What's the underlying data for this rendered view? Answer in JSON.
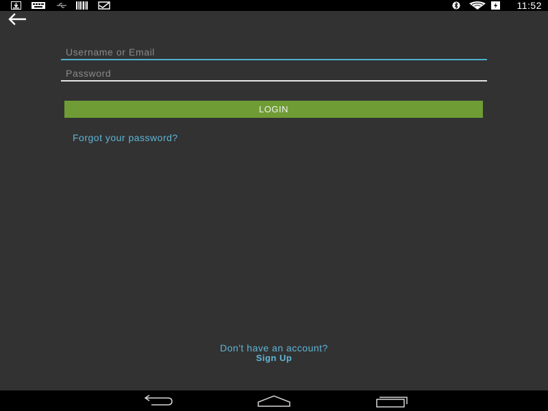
{
  "status_bar": {
    "time": "11:52",
    "left_icons": [
      "download-icon",
      "keyboard-icon",
      "usb-icon",
      "barcode-icon",
      "check-envelope-icon"
    ],
    "right_icons": [
      "bluetooth-icon",
      "wifi-icon",
      "battery-icon"
    ]
  },
  "toolbar": {
    "back_icon": "arrow-left-icon"
  },
  "login_form": {
    "username_placeholder": "Username or Email",
    "username_value": "",
    "password_placeholder": "Password",
    "password_value": "",
    "login_label": "LOGIN",
    "forgot_label": "Forgot your password?"
  },
  "signup": {
    "prompt": "Don't have an account?",
    "link_label": "Sign Up"
  },
  "nav_bar": {
    "buttons": [
      "back-icon",
      "home-icon",
      "recent-apps-icon"
    ]
  },
  "colors": {
    "background": "#323232",
    "accent": "#5fb6d6",
    "button": "#6f9c35",
    "bars": "#000000"
  }
}
